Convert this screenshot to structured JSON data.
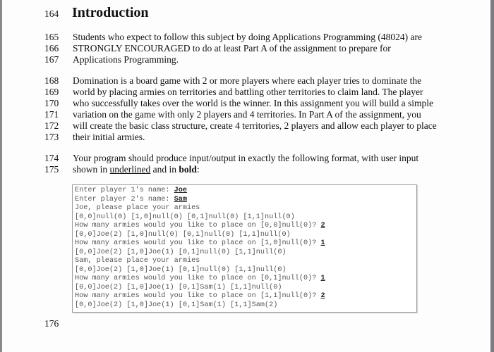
{
  "section": {
    "number": "164",
    "title": "Introduction"
  },
  "paragraphs": [
    {
      "lines": [
        {
          "num": "165",
          "text": "Students who expect to follow this subject by doing Applications Programming (48024) are"
        },
        {
          "num": "166",
          "text": "STRONGLY ENCOURAGED to do at least Part A of the assignment to prepare for"
        },
        {
          "num": "167",
          "text": "Applications Programming."
        }
      ]
    },
    {
      "lines": [
        {
          "num": "168",
          "text": "Domination is a board game with 2 or more players where each player tries to dominate the"
        },
        {
          "num": "169",
          "text": "world by placing armies on territories and battling other territories to claim land. The player"
        },
        {
          "num": "170",
          "text": "who successfully takes over the world is the winner. In this assignment you will build a simple"
        },
        {
          "num": "171",
          "text": "variation on the game with only 2 players and 4 territories. In Part A of the assignment, you"
        },
        {
          "num": "172",
          "text": "will create the basic class structure, create 4 territories, 2 players and allow each player to place"
        },
        {
          "num": "173",
          "text": "their initial armies."
        }
      ]
    },
    {
      "lines": [
        {
          "num": "174",
          "text": "Your program should produce input/output in exactly the following format, with user input"
        },
        {
          "num": "175",
          "text_before": "shown in ",
          "underlined": "underlined",
          "text_middle": " and in ",
          "bold": "bold",
          "text_after": ":"
        }
      ]
    }
  ],
  "code_sample": {
    "lines": [
      {
        "text": "Enter player 1's name: ",
        "input": "Joe"
      },
      {
        "text": "Enter player 2's name: ",
        "input": "Sam"
      },
      {
        "text": "Joe, please place your armies",
        "input": ""
      },
      {
        "text": "[0,0]null(0) [1,0]null(0) [0,1]null(0) [1,1]null(0)",
        "input": ""
      },
      {
        "text": "How many armies would you like to place on [0,0]null(0)? ",
        "input": "2"
      },
      {
        "text": "[0,0]Joe(2) [1,0]null(0) [0,1]null(0) [1,1]null(0)",
        "input": ""
      },
      {
        "text": "How many armies would you like to place on [1,0]null(0)? ",
        "input": "1"
      },
      {
        "text": "[0,0]Joe(2) [1,0]Joe(1) [0,1]null(0) [1,1]null(0)",
        "input": ""
      },
      {
        "text": "Sam, please place your armies",
        "input": ""
      },
      {
        "text": "[0,0]Joe(2) [1,0]Joe(1) [0,1]null(0) [1,1]null(0)",
        "input": ""
      },
      {
        "text": "How many armies would you like to place on [0,1]null(0)? ",
        "input": "1"
      },
      {
        "text": "[0,0]Joe(2) [1,0]Joe(1) [0,1]Sam(1) [1,1]null(0)",
        "input": ""
      },
      {
        "text": "How many armies would you like to place on [1,1]null(0)? ",
        "input": "2"
      },
      {
        "text": "[0,0]Joe(2) [1,0]Joe(1) [0,1]Sam(1) [1,1]Sam(2)",
        "input": ""
      }
    ]
  },
  "trailing_line_number": "176"
}
